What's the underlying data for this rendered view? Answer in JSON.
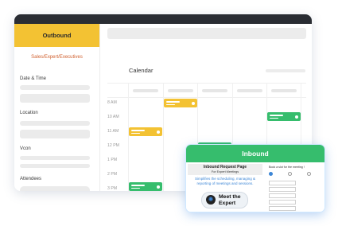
{
  "sidebar": {
    "title": "Outbound",
    "subtitle": "Sales/Expert/Executives",
    "labels": [
      "Date & Time",
      "Location",
      "Vcon",
      "Attendees"
    ]
  },
  "calendar": {
    "title": "Calendar",
    "times": [
      "8 AM",
      "10 AM",
      "11 AM",
      "12 PM",
      "1 PM",
      "2 PM",
      "3 PM",
      "4 PM"
    ]
  },
  "popup": {
    "title": "Inbound",
    "request_title": "Inbound Request Page",
    "request_subtitle": "For Expert Meetings",
    "description": "Simplifies the scheduling, managing & reporting of meetings and sessions.",
    "badge_line1": "Meet the",
    "badge_line2": "Expert",
    "form_title": "Book a slot for the meeting !"
  },
  "colors": {
    "yellow": "#f3c233",
    "green": "#36bd6d",
    "dark": "#2a2d33",
    "blue_text": "#3d86d6"
  }
}
